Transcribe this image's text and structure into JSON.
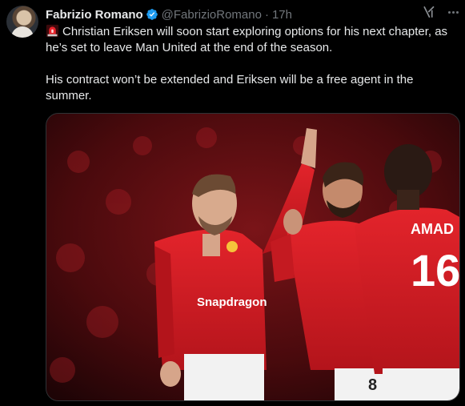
{
  "author": {
    "name": "Fabrizio Romano",
    "handle": "@FabrizioRomano",
    "separator": "·",
    "time": "17h"
  },
  "icons": {
    "avatar": "avatar-photo",
    "verified": "verified-badge-icon",
    "grok": "grok-icon",
    "more": "more-options-icon",
    "siren": "rotating-light-emoji"
  },
  "tweet": {
    "paragraph1": "Christian Eriksen will soon start exploring options for his next chapter, as he’s set to leave Man United at the end of the season.",
    "paragraph2": "His contract won’t be extended and Eriksen will be a free agent in the summer."
  },
  "media": {
    "alt": "Manchester United players celebrating in red kits",
    "shirt_sponsor": "Snapdragon",
    "player_name": "AMAD",
    "player_number": "16",
    "shorts_number": "8"
  },
  "colors": {
    "background": "#000000",
    "text": "#e7e9ea",
    "muted": "#71767b",
    "verified": "#1d9bf0",
    "kit_red": "#d11a22"
  }
}
